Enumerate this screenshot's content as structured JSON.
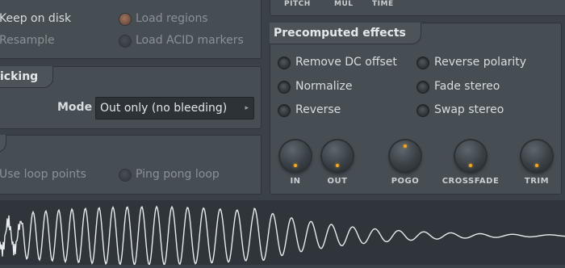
{
  "load_panel": {
    "keep_on_disk": "Keep on disk",
    "load_regions": "Load regions",
    "resample": "Resample",
    "load_acid_markers": "Load ACID markers"
  },
  "top_right_panel": {
    "pitch": "PITCH",
    "mul": "MUL",
    "time": "TIME"
  },
  "declicking": {
    "title": "icking",
    "mode_label": "Mode",
    "mode_value": "Out only (no bleeding)"
  },
  "loop_panel": {
    "use_loop_points": "Use loop points",
    "ping_pong_loop": "Ping pong loop"
  },
  "precomputed": {
    "title": "Precomputed effects",
    "options_left": [
      "Remove DC offset",
      "Normalize",
      "Reverse"
    ],
    "options_right": [
      "Reverse polarity",
      "Fade stereo",
      "Swap stereo"
    ],
    "knobs": [
      {
        "label": "IN"
      },
      {
        "label": "OUT"
      },
      {
        "label": "POGO"
      },
      {
        "label": "CROSSFADE"
      },
      {
        "label": "TRIM"
      }
    ]
  },
  "colors": {
    "accent": "#f5a623",
    "waveform": "#e8ecee",
    "panel": "#464d53"
  }
}
